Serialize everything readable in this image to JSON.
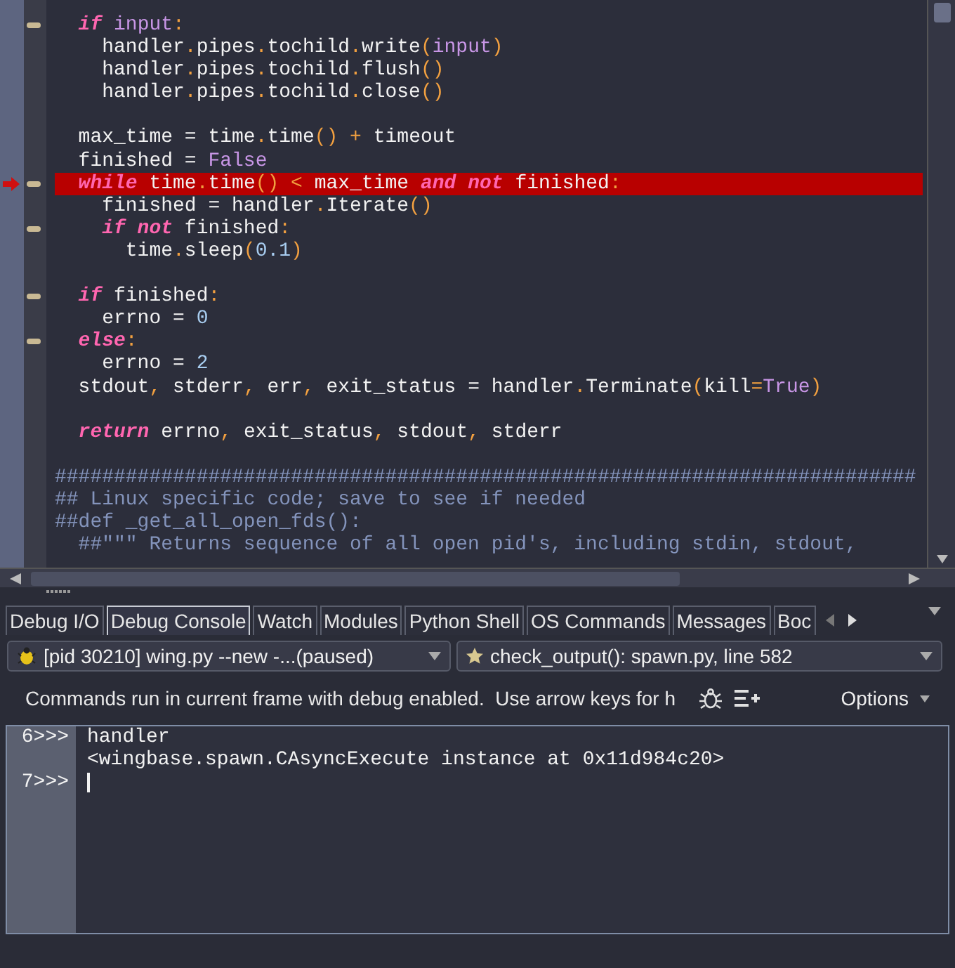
{
  "editor": {
    "lines": [
      {
        "kind": "code",
        "fold": true,
        "current": false,
        "tokens": [
          {
            "text": "if",
            "kind": "kw"
          },
          {
            "text": " input",
            "kind": "bi"
          },
          {
            "text": ":",
            "kind": "op"
          }
        ],
        "children": [
          {
            "kind": "code",
            "fold": false,
            "current": false,
            "tokens": [
              {
                "text": "handler.pipes.tochild.write",
                "kind": "path"
              },
              {
                "text": "(",
                "kind": "op"
              },
              {
                "text": "input",
                "kind": "bi"
              },
              {
                "text": ")",
                "kind": "op"
              }
            ]
          },
          {
            "kind": "code",
            "fold": false,
            "current": false,
            "tokens": [
              {
                "text": "handler.pipes.tochild.flush",
                "kind": "path"
              },
              {
                "text": "()",
                "kind": "op"
              }
            ]
          },
          {
            "kind": "code",
            "fold": false,
            "current": false,
            "tokens": [
              {
                "text": "handler.pipes.tochild.close",
                "kind": "path"
              },
              {
                "text": "()",
                "kind": "op"
              }
            ]
          }
        ]
      },
      {
        "kind": "blank"
      },
      {
        "kind": "code",
        "fold": false,
        "current": false,
        "tokens": [
          {
            "text": "max_time = time",
            "kind": "p"
          },
          {
            "text": ".",
            "kind": "op"
          },
          {
            "text": "time",
            "kind": "p"
          },
          {
            "text": "()",
            "kind": "op"
          },
          {
            "text": " +",
            "kind": "op"
          },
          {
            "text": " timeout",
            "kind": "p"
          }
        ]
      },
      {
        "kind": "code",
        "fold": false,
        "current": false,
        "tokens": [
          {
            "text": "finished = ",
            "kind": "p"
          },
          {
            "text": "False",
            "kind": "bi"
          }
        ]
      },
      {
        "kind": "code",
        "fold": true,
        "current": true,
        "tokens": [
          {
            "text": "while",
            "kind": "kw"
          },
          {
            "text": " time",
            "kind": "p"
          },
          {
            "text": ".",
            "kind": "op"
          },
          {
            "text": "time",
            "kind": "p"
          },
          {
            "text": "()",
            "kind": "op"
          },
          {
            "text": " <",
            "kind": "op"
          },
          {
            "text": " max_time ",
            "kind": "p"
          },
          {
            "text": "and",
            "kind": "kw"
          },
          {
            "text": " not",
            "kind": "kw"
          },
          {
            "text": " finished",
            "kind": "p"
          },
          {
            "text": ":",
            "kind": "op"
          }
        ],
        "children": [
          {
            "kind": "code",
            "fold": false,
            "current": false,
            "tokens": [
              {
                "text": "finished = handler",
                "kind": "p"
              },
              {
                "text": ".",
                "kind": "op"
              },
              {
                "text": "Iterate",
                "kind": "p"
              },
              {
                "text": "()",
                "kind": "op"
              }
            ]
          },
          {
            "kind": "code",
            "fold": true,
            "current": false,
            "tokens": [
              {
                "text": "if",
                "kind": "kw"
              },
              {
                "text": " not",
                "kind": "kw"
              },
              {
                "text": " finished",
                "kind": "p"
              },
              {
                "text": ":",
                "kind": "op"
              }
            ],
            "children": [
              {
                "kind": "code",
                "fold": false,
                "current": false,
                "tokens": [
                  {
                    "text": "time",
                    "kind": "p"
                  },
                  {
                    "text": ".",
                    "kind": "op"
                  },
                  {
                    "text": "sleep",
                    "kind": "p"
                  },
                  {
                    "text": "(",
                    "kind": "op"
                  },
                  {
                    "text": "0.1",
                    "kind": "num"
                  },
                  {
                    "text": ")",
                    "kind": "op"
                  }
                ]
              }
            ]
          }
        ]
      },
      {
        "kind": "blank"
      },
      {
        "kind": "code",
        "fold": true,
        "current": false,
        "tokens": [
          {
            "text": "if",
            "kind": "kw"
          },
          {
            "text": " finished",
            "kind": "p"
          },
          {
            "text": ":",
            "kind": "op"
          }
        ],
        "children": [
          {
            "kind": "code",
            "fold": false,
            "current": false,
            "tokens": [
              {
                "text": "errno = ",
                "kind": "p"
              },
              {
                "text": "0",
                "kind": "num"
              }
            ]
          }
        ]
      },
      {
        "kind": "code",
        "fold": true,
        "current": false,
        "tokens": [
          {
            "text": "else",
            "kind": "kw"
          },
          {
            "text": ":",
            "kind": "op"
          }
        ],
        "children": [
          {
            "kind": "code",
            "fold": false,
            "current": false,
            "tokens": [
              {
                "text": "errno = ",
                "kind": "p"
              },
              {
                "text": "2",
                "kind": "num"
              }
            ]
          }
        ]
      },
      {
        "kind": "code",
        "fold": false,
        "current": false,
        "tokens": [
          {
            "text": "stdout",
            "kind": "p"
          },
          {
            "text": ",",
            "kind": "op"
          },
          {
            "text": " stderr",
            "kind": "p"
          },
          {
            "text": ",",
            "kind": "op"
          },
          {
            "text": " err",
            "kind": "p"
          },
          {
            "text": ",",
            "kind": "op"
          },
          {
            "text": " exit_status = handler",
            "kind": "p"
          },
          {
            "text": ".",
            "kind": "op"
          },
          {
            "text": "Terminate",
            "kind": "p"
          },
          {
            "text": "(",
            "kind": "op"
          },
          {
            "text": "kill",
            "kind": "p"
          },
          {
            "text": "=",
            "kind": "op"
          },
          {
            "text": "True",
            "kind": "bi"
          },
          {
            "text": ")",
            "kind": "op"
          }
        ]
      },
      {
        "kind": "blank"
      },
      {
        "kind": "code",
        "fold": false,
        "current": false,
        "tokens": [
          {
            "text": "return",
            "kind": "kw"
          },
          {
            "text": " errno",
            "kind": "p"
          },
          {
            "text": ",",
            "kind": "op"
          },
          {
            "text": " exit_status",
            "kind": "p"
          },
          {
            "text": ",",
            "kind": "op"
          },
          {
            "text": " stdout",
            "kind": "p"
          },
          {
            "text": ",",
            "kind": "op"
          },
          {
            "text": " stderr",
            "kind": "p"
          }
        ]
      },
      {
        "kind": "blank"
      },
      {
        "kind": "comment",
        "fold": false,
        "current": false,
        "tokens": [
          {
            "text": "#########################################################################",
            "kind": "cm"
          }
        ]
      },
      {
        "kind": "comment",
        "fold": false,
        "current": false,
        "tokens": [
          {
            "text": "## Linux specific code; save to see if needed",
            "kind": "cm"
          }
        ]
      },
      {
        "kind": "comment",
        "fold": false,
        "current": false,
        "tokens": [
          {
            "text": "##def _get_all_open_fds():",
            "kind": "cm"
          }
        ],
        "children": [
          {
            "kind": "comment",
            "fold": false,
            "current": false,
            "tokens": [
              {
                "text": "##\"\"\" Returns sequence of all open pid's, including stdin, stdout,",
                "kind": "cm"
              }
            ]
          }
        ]
      }
    ]
  },
  "panel": {
    "tabs": [
      {
        "label": "Debug I/O",
        "selected": false
      },
      {
        "label": "Debug Console",
        "selected": true
      },
      {
        "label": "Watch",
        "selected": false
      },
      {
        "label": "Modules",
        "selected": false
      },
      {
        "label": "Python Shell",
        "selected": false
      },
      {
        "label": "OS Commands",
        "selected": false
      },
      {
        "label": "Messages",
        "selected": false
      },
      {
        "label": "Boc",
        "selected": false
      }
    ],
    "process_select": "[pid 30210] wing.py --new -...(paused)",
    "frame_select": "check_output(): spawn.py, line 582",
    "hint": "Commands run in current frame with debug enabled.  Use arrow keys for h",
    "options_button": "Options",
    "console": [
      {
        "prompt": "6>>>",
        "text": "handler",
        "cursor": false
      },
      {
        "text": "<wingbase.spawn.CAsyncExecute instance at 0x11d984c20>",
        "cursor": false
      },
      {
        "prompt": "7>>>",
        "cursor": true
      }
    ]
  }
}
